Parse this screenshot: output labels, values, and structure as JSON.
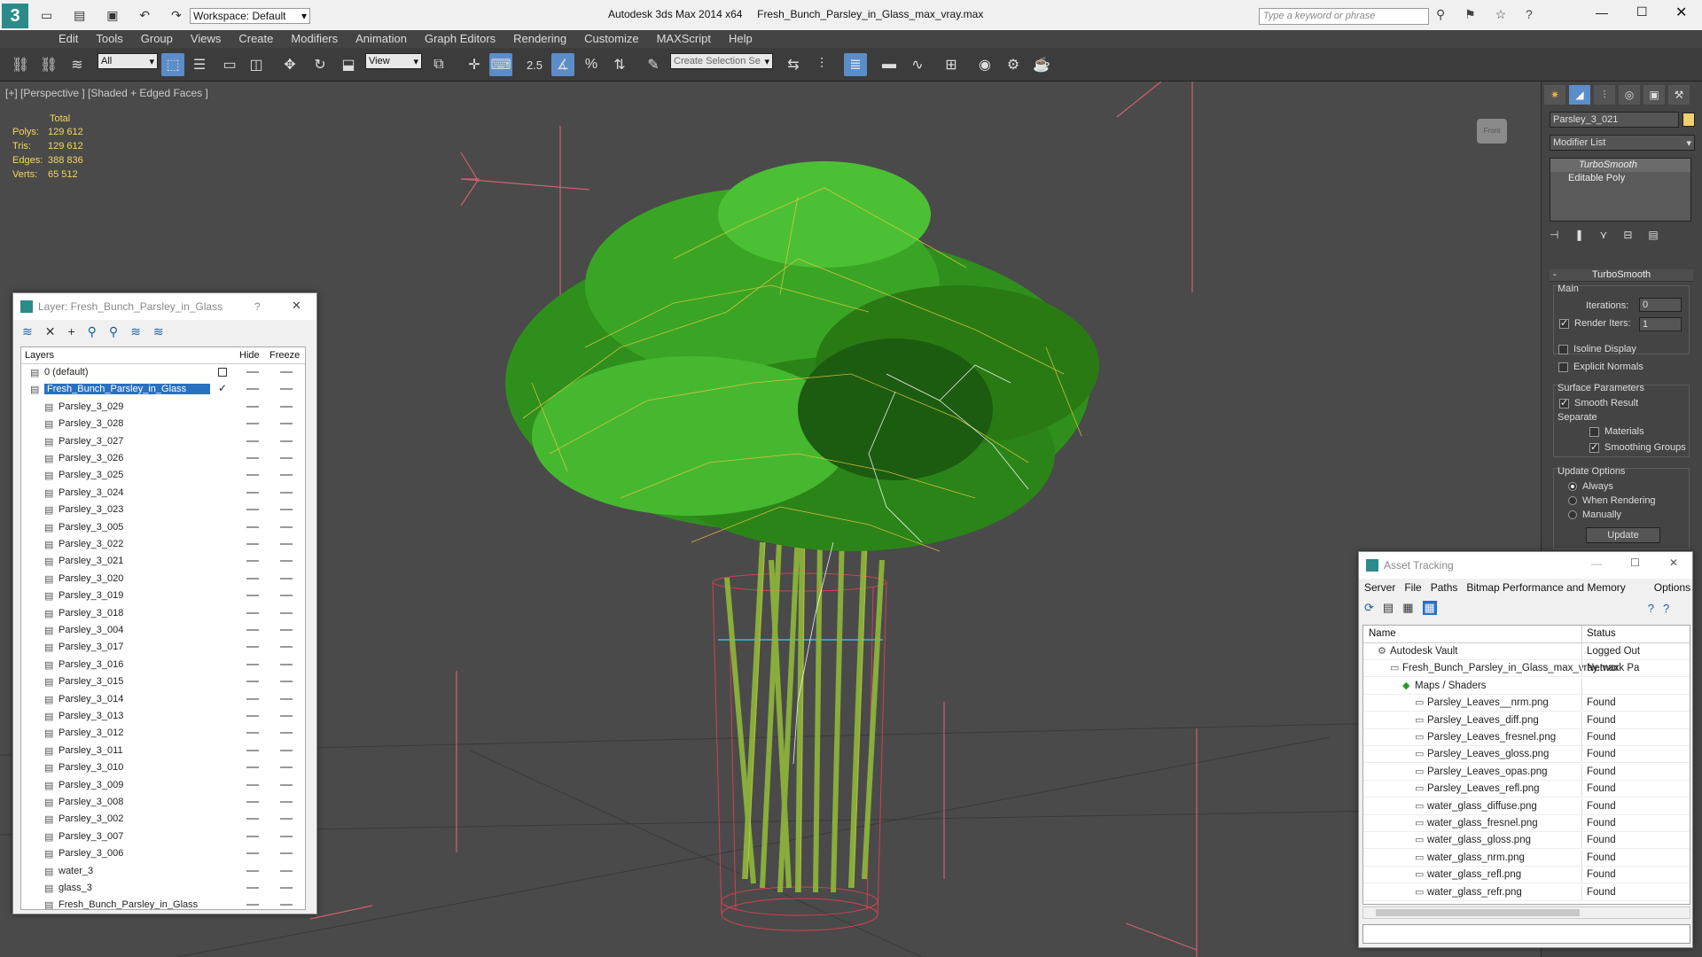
{
  "app": {
    "title_left": "Autodesk 3ds Max  2014 x64",
    "file_title": "Fresh_Bunch_Parsley_in_Glass_max_vray.max",
    "workspace": "Workspace: Default",
    "search_placeholder": "Type a keyword or phrase"
  },
  "menu": [
    "Edit",
    "Tools",
    "Group",
    "Views",
    "Create",
    "Modifiers",
    "Animation",
    "Graph Editors",
    "Rendering",
    "Customize",
    "MAXScript",
    "Help"
  ],
  "toolbar": {
    "selection_filter": "All",
    "ref_coord": "View",
    "snap_value": "2.5",
    "selection_set_placeholder": "Create Selection Se"
  },
  "viewport": {
    "label": "[+] [Perspective ] [Shaded + Edged Faces ]",
    "stats_header": "Total",
    "stats": [
      {
        "k": "Polys:",
        "v": "129 612"
      },
      {
        "k": "Tris:",
        "v": "129 612"
      },
      {
        "k": "Edges:",
        "v": "388 836"
      },
      {
        "k": "Verts:",
        "v": "65 512"
      }
    ]
  },
  "layer_window": {
    "title": "Layer: Fresh_Bunch_Parsley_in_Glass",
    "help": "?",
    "col_layers": "Layers",
    "col_hide": "Hide",
    "col_freeze": "Freeze",
    "default_layer": "0 (default)",
    "active_layer": "Fresh_Bunch_Parsley_in_Glass",
    "objects": [
      "Parsley_3_029",
      "Parsley_3_028",
      "Parsley_3_027",
      "Parsley_3_026",
      "Parsley_3_025",
      "Parsley_3_024",
      "Parsley_3_023",
      "Parsley_3_005",
      "Parsley_3_022",
      "Parsley_3_021",
      "Parsley_3_020",
      "Parsley_3_019",
      "Parsley_3_018",
      "Parsley_3_004",
      "Parsley_3_017",
      "Parsley_3_016",
      "Parsley_3_015",
      "Parsley_3_014",
      "Parsley_3_013",
      "Parsley_3_012",
      "Parsley_3_011",
      "Parsley_3_010",
      "Parsley_3_009",
      "Parsley_3_008",
      "Parsley_3_002",
      "Parsley_3_007",
      "Parsley_3_006",
      "water_3",
      "glass_3",
      "Fresh_Bunch_Parsley_in_Glass"
    ]
  },
  "command_panel": {
    "object_name": "Parsley_3_021",
    "modifier_list": "Modifier List",
    "stack": [
      "TurboSmooth",
      "Editable Poly"
    ],
    "rollout_title": "TurboSmooth",
    "main_label": "Main",
    "iterations_label": "Iterations:",
    "iterations_value": "0",
    "render_iters_label": "Render Iters:",
    "render_iters_value": "1",
    "isoline": "Isoline Display",
    "explicit_normals": "Explicit Normals",
    "surface_params": "Surface Parameters",
    "smooth_result": "Smooth Result",
    "separate": "Separate",
    "materials": "Materials",
    "smoothing_groups": "Smoothing Groups",
    "update_options": "Update Options",
    "always": "Always",
    "when_rendering": "When Rendering",
    "manually": "Manually",
    "update_btn": "Update"
  },
  "asset_window": {
    "title": "Asset Tracking",
    "menu": [
      "Server",
      "File",
      "Paths",
      "Bitmap Performance and Memory",
      "Options"
    ],
    "col_name": "Name",
    "col_status": "Status",
    "rows": [
      {
        "name": "Autodesk Vault",
        "status": "Logged Out"
      },
      {
        "name": "Fresh_Bunch_Parsley_in_Glass_max_vray.max",
        "status": "Network Pa"
      },
      {
        "name": "Maps / Shaders",
        "status": ""
      },
      {
        "name": "Parsley_Leaves__nrm.png",
        "status": "Found"
      },
      {
        "name": "Parsley_Leaves_diff.png",
        "status": "Found"
      },
      {
        "name": "Parsley_Leaves_fresnel.png",
        "status": "Found"
      },
      {
        "name": "Parsley_Leaves_gloss.png",
        "status": "Found"
      },
      {
        "name": "Parsley_Leaves_opas.png",
        "status": "Found"
      },
      {
        "name": "Parsley_Leaves_refl.png",
        "status": "Found"
      },
      {
        "name": "water_glass_diffuse.png",
        "status": "Found"
      },
      {
        "name": "water_glass_fresnel.png",
        "status": "Found"
      },
      {
        "name": "water_glass_gloss.png",
        "status": "Found"
      },
      {
        "name": "water_glass_nrm.png",
        "status": "Found"
      },
      {
        "name": "water_glass_refl.png",
        "status": "Found"
      },
      {
        "name": "water_glass_refr.png",
        "status": "Found"
      }
    ]
  }
}
